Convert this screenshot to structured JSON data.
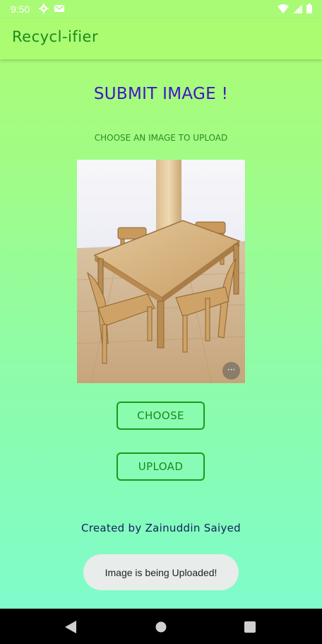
{
  "status_bar": {
    "time": "9:50",
    "left_icons": [
      "settings-icon",
      "mail-icon"
    ],
    "right_icons": [
      "wifi-icon",
      "signal-icon",
      "battery-icon"
    ]
  },
  "app_bar": {
    "title": "Recycl-ifier"
  },
  "main": {
    "heading": "SUBMIT IMAGE !",
    "subheading": "CHOOSE AN IMAGE TO UPLOAD",
    "image_more_label": "···",
    "choose_label": "CHOOSE",
    "upload_label": "UPLOAD",
    "credit": "Created  by  Zainuddin Saiyed"
  },
  "toast": {
    "message": "Image is being Uploaded!"
  },
  "colors": {
    "app_bar": "#acfc72",
    "gradient_top": "#acfc72",
    "gradient_bottom": "#7cfcd0",
    "heading": "#3f14c4",
    "button_border": "#1a9a1a",
    "credit": "#11225a"
  },
  "nav_bar": {
    "icons": [
      "back-icon",
      "home-icon",
      "recents-icon"
    ]
  }
}
